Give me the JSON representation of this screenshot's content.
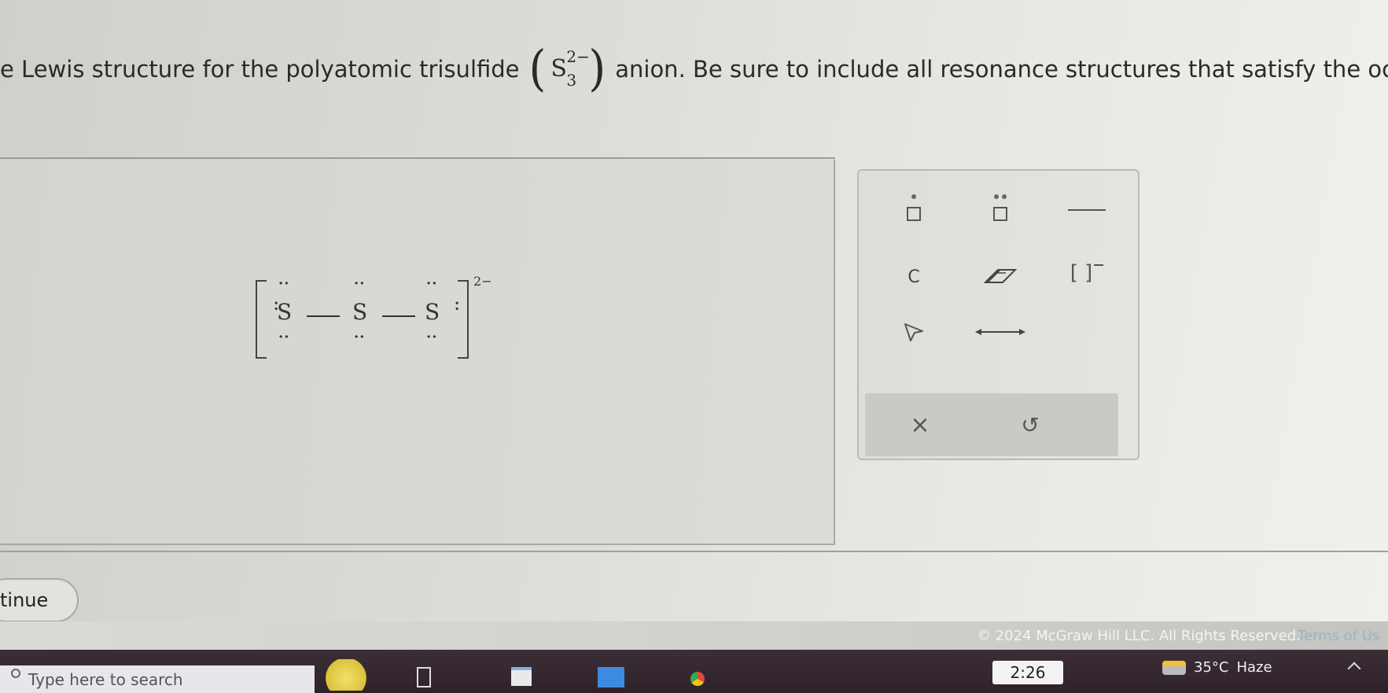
{
  "question": {
    "prefix": "e Lewis structure for the polyatomic trisulfide",
    "formula_element": "S",
    "formula_charge": "2−",
    "formula_count": "3",
    "suffix": "anion. Be sure to include all resonance structures that satisfy the octet rul"
  },
  "lewis_structure": {
    "atoms": [
      "S",
      "S",
      "S"
    ],
    "charge": "2−"
  },
  "palette": {
    "tools": [
      {
        "name": "single-dot-tool",
        "icon": "dot-square-icon"
      },
      {
        "name": "lone-pair-tool",
        "icon": "double-dot-square-icon"
      },
      {
        "name": "bond-tool",
        "icon": "line-icon"
      },
      {
        "name": "carbon-tool",
        "label": "C"
      },
      {
        "name": "eraser-tool",
        "icon": "eraser-icon"
      },
      {
        "name": "bracket-charge-tool",
        "label": "[ ]"
      },
      {
        "name": "select-tool",
        "icon": "cursor-icon"
      },
      {
        "name": "resonance-arrow-tool",
        "icon": "double-arrow-icon"
      }
    ],
    "clear_label": "×",
    "undo_label": "↺"
  },
  "continue_label": "tinue",
  "footer": {
    "copyright": "© 2024 McGraw Hill LLC. All Rights Reserved.",
    "terms": "Terms of Us"
  },
  "taskbar": {
    "search_placeholder": "Type here to search",
    "time": "2:26",
    "temperature": "35°C",
    "weather": "Haze"
  }
}
